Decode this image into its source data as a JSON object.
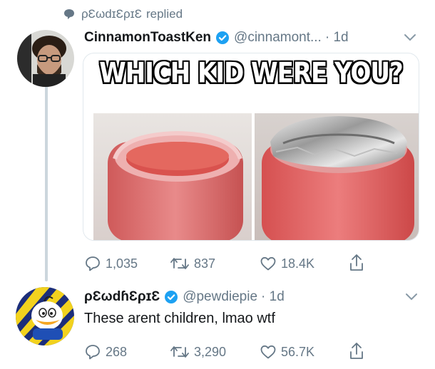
{
  "context": {
    "replier": "ρƐωdɪƐρɪƐ",
    "action": "replied"
  },
  "tweet": {
    "author_name": "CinnamonToastKen",
    "handle": "@cinnamont...",
    "time": "· 1d",
    "media": {
      "caption": "WHICH KID WERE YOU?"
    },
    "actions": {
      "replies": "1,035",
      "retweets": "837",
      "likes": "18.4K"
    }
  },
  "reply": {
    "author_name": "ρƐωdɦƐρɪƐ",
    "handle": "@pewdiepie",
    "time": "· 1d",
    "text": "These arent children, lmao wtf",
    "actions": {
      "replies": "268",
      "retweets": "3,290",
      "likes": "56.7K"
    }
  },
  "colors": {
    "verified": "#1da1f2",
    "muted": "#657786",
    "thread_line": "#ccd6dd"
  },
  "icons": [
    "speech-bubble-icon",
    "verified-badge-icon",
    "chevron-down-icon",
    "reply-icon",
    "retweet-icon",
    "heart-icon",
    "share-icon"
  ]
}
